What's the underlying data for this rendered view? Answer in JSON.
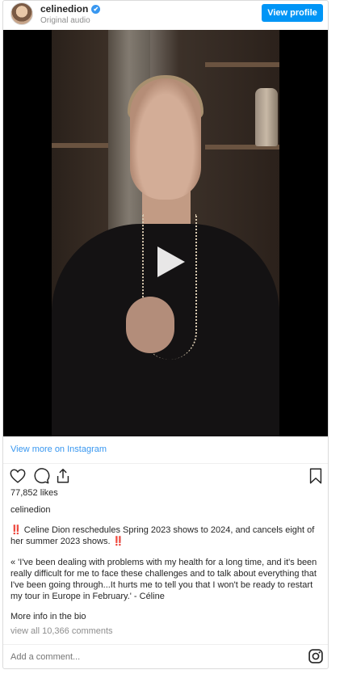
{
  "header": {
    "username": "celinedion",
    "subtitle": "Original audio",
    "view_profile_label": "View profile",
    "verified_mark": "✔"
  },
  "media": {
    "play_icon": "play-icon"
  },
  "links": {
    "view_more": "View more on Instagram"
  },
  "actions": {
    "icons": [
      "heart-icon",
      "comment-icon",
      "share-icon",
      "bookmark-icon"
    ]
  },
  "post": {
    "likes": "77,852 likes",
    "caption_user": "celinedion",
    "paragraph1": "‼️ Celine Dion reschedules Spring 2023 shows to 2024, and cancels eight of her summer 2023 shows. ‼️",
    "paragraph2": "« 'I've been dealing with problems with my health for a long time, and it's been really difficult for me to face these challenges and to talk about everything that I've been going through...It hurts me to tell you that I won't be ready to restart my tour in Europe in February.' - Céline",
    "more_info": "More info in the bio",
    "view_comments": "view all 10,366 comments"
  },
  "comment": {
    "placeholder": "Add a comment..."
  },
  "colors": {
    "accent": "#0095f6",
    "link": "#3897f0",
    "muted": "#8e8e8e"
  }
}
